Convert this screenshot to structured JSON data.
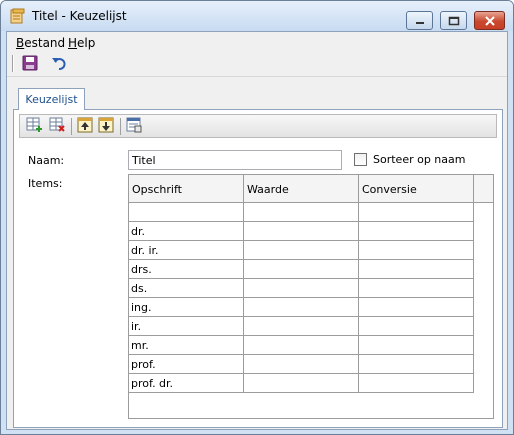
{
  "window": {
    "title": "Titel - Keuzelijst"
  },
  "menu": [
    {
      "label": "Bestand",
      "accel": "B",
      "rest": "estand"
    },
    {
      "label": "Help",
      "accel": "H",
      "rest": "elp"
    }
  ],
  "toolbar": {
    "save_icon": "save-icon",
    "undo_icon": "undo-icon"
  },
  "tabs": [
    {
      "label": "Keuzelijst",
      "active": true
    }
  ],
  "inner_toolbar": [
    "add-row-icon",
    "delete-row-icon",
    "move-up-icon",
    "move-down-icon",
    "properties-icon"
  ],
  "form": {
    "naam_label": "Naam:",
    "naam_value": "Titel",
    "sort_label": "Sorteer op naam",
    "sort_checked": false,
    "items_label": "Items:"
  },
  "grid": {
    "columns": [
      "Opschrift",
      "Waarde",
      "Conversie"
    ],
    "rows": [
      [
        "",
        "",
        ""
      ],
      [
        "dr.",
        "",
        ""
      ],
      [
        "dr. ir.",
        "",
        ""
      ],
      [
        "drs.",
        "",
        ""
      ],
      [
        "ds.",
        "",
        ""
      ],
      [
        "ing.",
        "",
        ""
      ],
      [
        "ir.",
        "",
        ""
      ],
      [
        "mr.",
        "",
        ""
      ],
      [
        "prof.",
        "",
        ""
      ],
      [
        "prof. dr.",
        "",
        ""
      ]
    ]
  },
  "colors": {
    "title_gradient_top": "#e7f0fb",
    "tab_text": "#1e4f8a",
    "close_button": "#c9492e"
  }
}
